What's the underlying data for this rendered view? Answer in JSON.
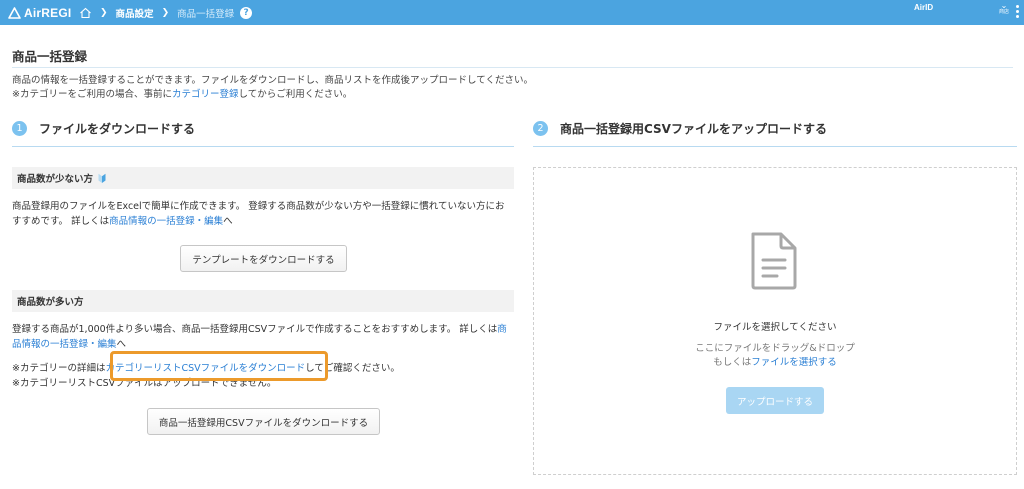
{
  "header": {
    "logo_text": "AirREGI",
    "breadcrumb": [
      "商品設定",
      "商品一括登録"
    ],
    "help_label": "?",
    "airid": "AirID",
    "account_label": "商店",
    "colors": {
      "bar": "#4ba4e0",
      "link": "#2a7fd4",
      "highlight": "#ec9a2b"
    }
  },
  "page": {
    "title": "商品一括登録",
    "intro_line1": "商品の情報を一括登録することができます。ファイルをダウンロードし、商品リストを作成後アップロードしてください。",
    "intro_line2_pre": "※カテゴリーをご利用の場合、事前に",
    "intro_line2_link": "カテゴリー登録",
    "intro_line2_post": "してからご利用ください。"
  },
  "step1": {
    "num": "1",
    "label": "ファイルをダウンロードする",
    "few": {
      "heading": "商品数が少ない方",
      "desc_pre": "商品登録用のファイルをExcelで簡単に作成できます。 登録する商品数が少ない方や一括登録に慣れていない方にお",
      "desc_line2_pre": "すすめです。 詳しくは",
      "desc_link": "商品情報の一括登録・編集",
      "desc_post": "へ",
      "button": "テンプレートをダウンロードする"
    },
    "many": {
      "heading": "商品数が多い方",
      "desc_pre": "登録する商品が1,000件より多い場合、商品一括登録用CSVファイルで作成することをおすすめします。 詳しくは",
      "desc_link_a": "商",
      "desc_link_b": "品情報の一括登録・編集",
      "desc_post": "へ",
      "note1_pre": "※カテゴリーの詳細は",
      "note1_link": "カテゴリーリストCSVファイルをダウンロード",
      "note1_post": "してご確認ください。",
      "note2": "※カテゴリーリストCSVファイルはアップロードできません。",
      "button": "商品一括登録用CSVファイルをダウンロードする"
    }
  },
  "step2": {
    "num": "2",
    "label": "商品一括登録用CSVファイルをアップロードする",
    "dropzone": {
      "icon": "document-icon",
      "title": "ファイルを選択してください",
      "hint_line1": "ここにファイルをドラッグ&ドロップ",
      "hint_line2_pre": "もしくは",
      "hint_link": "ファイルを選択する",
      "upload_button": "アップロードする"
    }
  }
}
